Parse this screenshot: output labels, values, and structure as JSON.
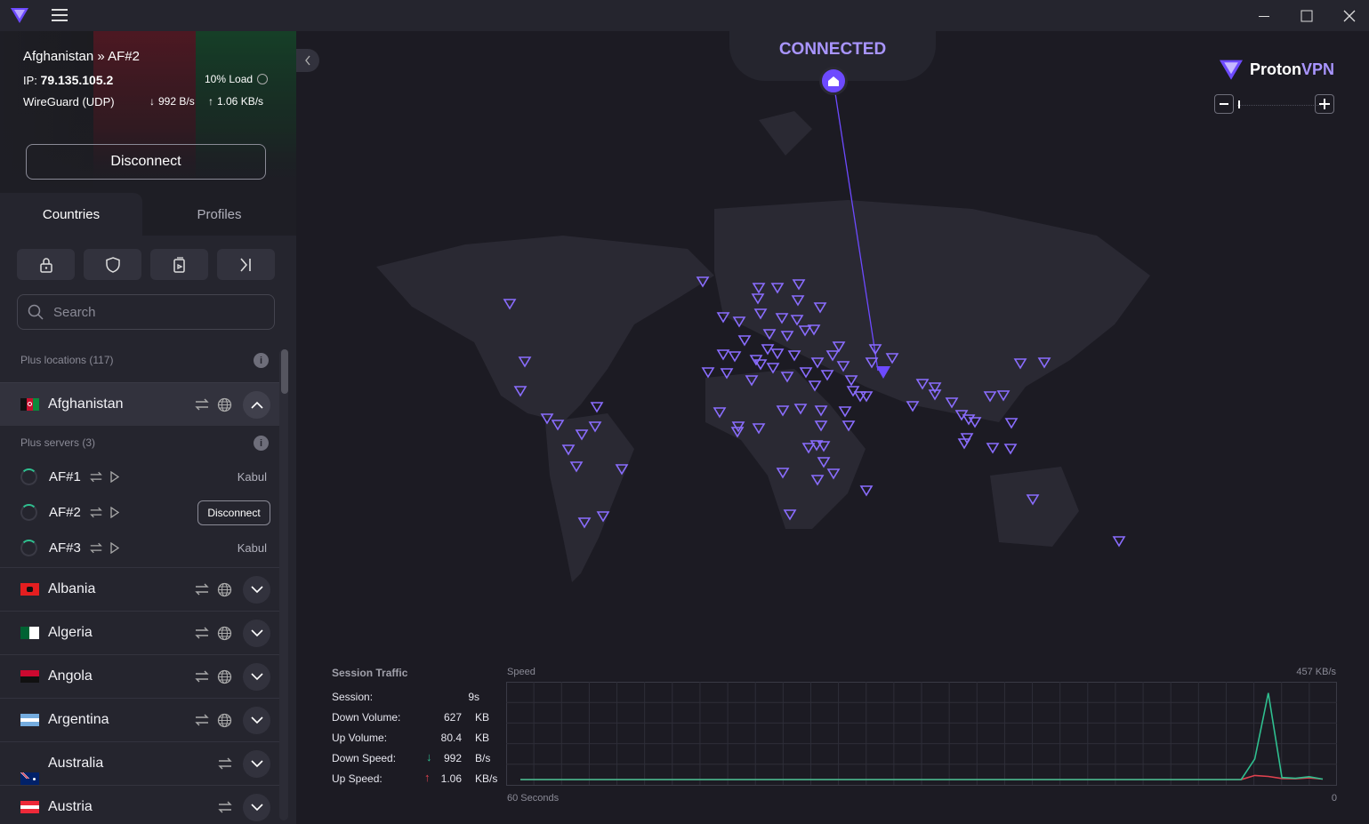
{
  "window": {
    "controls": [
      "minimize",
      "maximize",
      "close"
    ]
  },
  "connection": {
    "location": "Afghanistan » AF#2",
    "ip_label": "IP:",
    "ip": "79.135.105.2",
    "load": "10% Load",
    "protocol": "WireGuard (UDP)",
    "down_rate": "992 B/s",
    "up_rate": "1.06 KB/s",
    "disconnect_label": "Disconnect",
    "status": "CONNECTED"
  },
  "tabs": {
    "countries": "Countries",
    "profiles": "Profiles"
  },
  "filters": [
    "lock-icon",
    "shield-icon",
    "streaming-icon",
    "split-tunnel-icon"
  ],
  "search": {
    "placeholder": "Search"
  },
  "list": {
    "plus_locations": "Plus locations (117)",
    "plus_servers": "Plus servers (3)",
    "expanded_country": "Afghanistan",
    "servers": [
      {
        "name": "AF#1",
        "city": "Kabul"
      },
      {
        "name": "AF#2",
        "action": "Disconnect"
      },
      {
        "name": "AF#3",
        "city": "Kabul"
      }
    ],
    "countries": [
      "Albania",
      "Algeria",
      "Angola",
      "Argentina",
      "Australia",
      "Austria"
    ]
  },
  "brand": {
    "name_a": "Proton",
    "name_b": "VPN",
    "accent": "#6d4aff"
  },
  "session": {
    "title": "Session Traffic",
    "rows": [
      {
        "label": "Session:",
        "value": "9s",
        "unit": ""
      },
      {
        "label": "Down Volume:",
        "value": "627",
        "unit": "KB"
      },
      {
        "label": "Up Volume:",
        "value": "80.4",
        "unit": "KB"
      },
      {
        "label": "Down Speed:",
        "value": "992",
        "unit": "B/s"
      },
      {
        "label": "Up Speed:",
        "value": "1.06",
        "unit": "KB/s"
      }
    ]
  },
  "chart_data": {
    "type": "line",
    "title": "Speed",
    "ymax_label": "457  KB/s",
    "xlabel_left": "60 Seconds",
    "xlabel_right": "0",
    "x": [
      0,
      1,
      2,
      3,
      4,
      5,
      6,
      7,
      8,
      9,
      10,
      11,
      12,
      13,
      14,
      15,
      16,
      17,
      18,
      19,
      20,
      21,
      22,
      23,
      24,
      25,
      26,
      27,
      28,
      29,
      30,
      31,
      32,
      33,
      34,
      35,
      36,
      37,
      38,
      39,
      40,
      41,
      42,
      43,
      44,
      45,
      46,
      47,
      48,
      49,
      50,
      51,
      52,
      53,
      54,
      55,
      56,
      57,
      58,
      59
    ],
    "ylim": [
      0,
      457
    ],
    "series": [
      {
        "color": "#2fbf8f",
        "values": [
          0,
          0,
          0,
          0,
          0,
          0,
          0,
          0,
          0,
          0,
          0,
          0,
          0,
          0,
          0,
          0,
          0,
          0,
          0,
          0,
          0,
          0,
          0,
          0,
          0,
          0,
          0,
          0,
          0,
          0,
          0,
          0,
          0,
          0,
          0,
          0,
          0,
          0,
          0,
          0,
          0,
          0,
          0,
          0,
          0,
          0,
          0,
          0,
          0,
          0,
          0,
          0,
          0,
          0,
          100,
          420,
          10,
          6,
          14,
          2
        ]
      },
      {
        "color": "#e0424f",
        "values": [
          0,
          0,
          0,
          0,
          0,
          0,
          0,
          0,
          0,
          0,
          0,
          0,
          0,
          0,
          0,
          0,
          0,
          0,
          0,
          0,
          0,
          0,
          0,
          0,
          0,
          0,
          0,
          0,
          0,
          0,
          0,
          0,
          0,
          0,
          0,
          0,
          0,
          0,
          0,
          0,
          0,
          0,
          0,
          0,
          0,
          0,
          0,
          0,
          0,
          0,
          0,
          0,
          0,
          0,
          20,
          15,
          5,
          4,
          8,
          2
        ]
      }
    ]
  }
}
